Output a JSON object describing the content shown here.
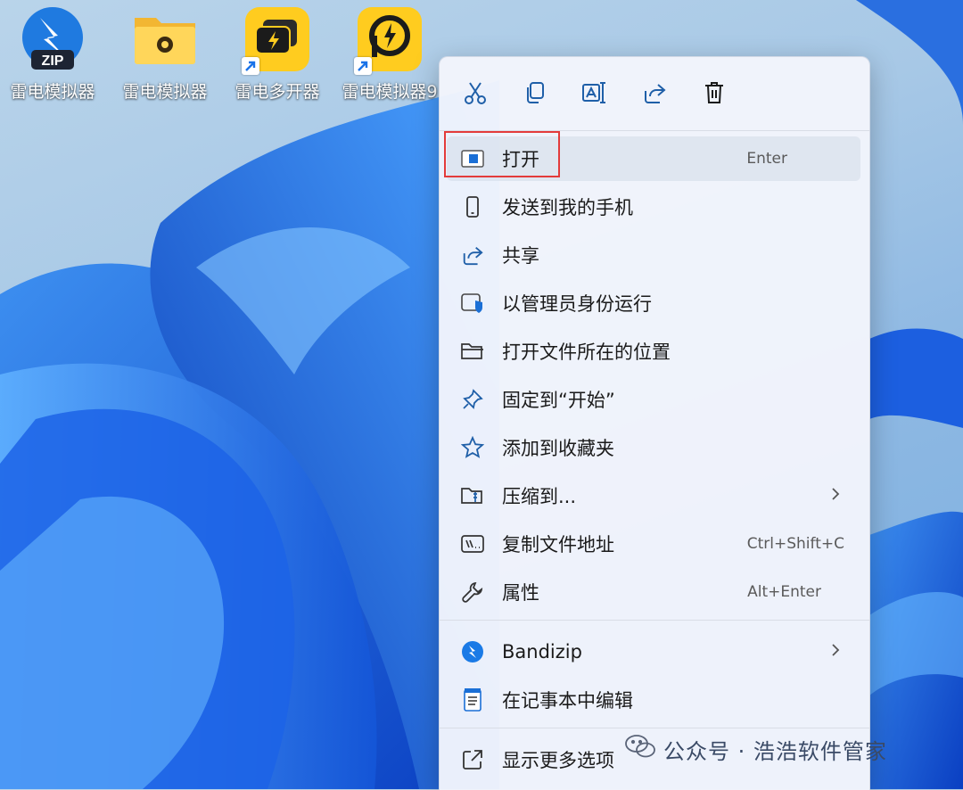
{
  "desktop": {
    "icons": [
      {
        "label": "雷电模拟器",
        "icon": "zip-archive-icon"
      },
      {
        "label": "雷电模拟器",
        "icon": "folder-icon"
      },
      {
        "label": "雷电多开器",
        "icon": "multi-instance-app-icon"
      },
      {
        "label": "雷电模拟器9",
        "icon": "emulator-app-icon"
      }
    ]
  },
  "menu": {
    "toolbar": [
      "cut-icon",
      "copy-icon",
      "rename-icon",
      "share-icon",
      "delete-icon"
    ],
    "items": [
      {
        "label": "打开",
        "shortcut": "Enter",
        "icon": "open-app-icon"
      },
      {
        "label": "发送到我的手机",
        "shortcut": "",
        "icon": "phone-icon"
      },
      {
        "label": "共享",
        "shortcut": "",
        "icon": "share-icon"
      },
      {
        "label": "以管理员身份运行",
        "shortcut": "",
        "icon": "admin-shield-icon"
      },
      {
        "label": "打开文件所在的位置",
        "shortcut": "",
        "icon": "folder-open-icon"
      },
      {
        "label": "固定到“开始”",
        "shortcut": "",
        "icon": "pin-icon"
      },
      {
        "label": "添加到收藏夹",
        "shortcut": "",
        "icon": "star-icon"
      },
      {
        "label": "压缩到...",
        "shortcut": "",
        "icon": "zip-folder-icon"
      },
      {
        "label": "复制文件地址",
        "shortcut": "Ctrl+Shift+C",
        "icon": "copy-path-icon"
      },
      {
        "label": "属性",
        "shortcut": "Alt+Enter",
        "icon": "wrench-icon"
      },
      {
        "label": "Bandizip",
        "shortcut": "",
        "icon": "bandizip-icon"
      },
      {
        "label": "在记事本中编辑",
        "shortcut": "",
        "icon": "notepad-icon"
      },
      {
        "label": "显示更多选项",
        "shortcut": "",
        "icon": "more-options-icon"
      }
    ]
  },
  "watermark": {
    "text": "公众号 · 浩浩软件管家"
  },
  "colors": {
    "highlight": "#e33b3b",
    "accent": "#0067c0"
  }
}
